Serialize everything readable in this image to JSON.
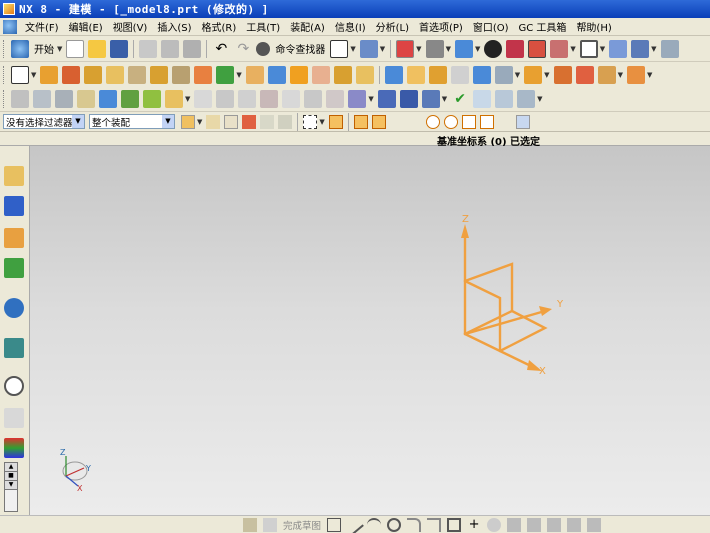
{
  "window": {
    "title": "NX 8 - 建模 - [_model8.prt (修改的) ]"
  },
  "menu": {
    "items": [
      "文件(F)",
      "编辑(E)",
      "视图(V)",
      "插入(S)",
      "格式(R)",
      "工具(T)",
      "装配(A)",
      "信息(I)",
      "分析(L)",
      "首选项(P)",
      "窗口(O)",
      "GC 工具箱",
      "帮助(H)"
    ]
  },
  "toolbar1": {
    "start_label": "开始",
    "command_finder_label": "命令查找器"
  },
  "selection": {
    "filter_value": "没有选择过滤器",
    "scope_value": "整个装配"
  },
  "status": {
    "message": "基准坐标系 (0) 已选定"
  },
  "csys": {
    "z_label": "Z",
    "y_label": "Y",
    "x_label": "X"
  },
  "triad": {
    "z_label": "Z",
    "y_label": "Y",
    "x_label": "X"
  },
  "bottom": {
    "finish_sketch_label": "完成草图"
  },
  "colors": {
    "datum": "#f0a040",
    "title_bg": "#0a3fb8"
  }
}
